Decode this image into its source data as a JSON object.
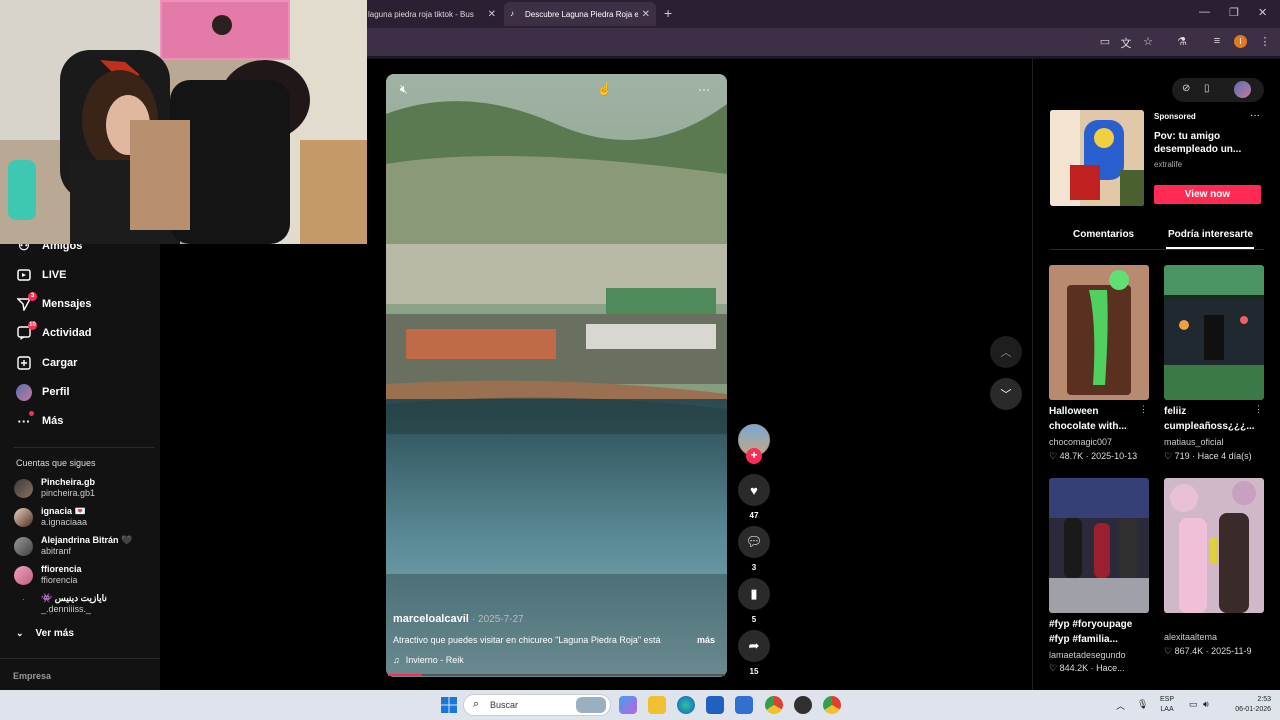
{
  "browser": {
    "tabs": [
      {
        "title": "laguna piedra roja tiktok - Bus",
        "active": false
      },
      {
        "title": "Descubre Laguna Piedra Roja e",
        "active": true
      }
    ],
    "new_tab_icon": "plus-icon"
  },
  "sidebar": {
    "items": [
      {
        "label": "Amigos",
        "icon": "friends-icon",
        "badge": ""
      },
      {
        "label": "LIVE",
        "icon": "live-icon",
        "badge": ""
      },
      {
        "label": "Mensajes",
        "icon": "messages-icon",
        "badge": "3"
      },
      {
        "label": "Actividad",
        "icon": "activity-icon",
        "badge": "10"
      },
      {
        "label": "Cargar",
        "icon": "upload-icon",
        "badge": ""
      },
      {
        "label": "Perfil",
        "icon": "profile-icon",
        "badge": ""
      },
      {
        "label": "Más",
        "icon": "more-icon",
        "badge": ""
      }
    ],
    "following_title": "Cuentas que sigues",
    "accounts": [
      {
        "name": "Pincheira.gb",
        "handle": "pincheira.gb1"
      },
      {
        "name": "ignacia 💌",
        "handle": "a.ignaciaaa"
      },
      {
        "name": "Alejandrina Bitrán 🖤",
        "handle": "abitranf"
      },
      {
        "name": "ffiorencia",
        "handle": "ffiorencia"
      },
      {
        "name": "👾 نايازيت دينيس",
        "handle": "_.denniiiss._"
      }
    ],
    "see_more": "Ver más",
    "company": "Empresa"
  },
  "video": {
    "username": "marceloalcavil",
    "date": "2025-7-27",
    "caption": "Atractivo que puedes visitar en chicureo \"Laguna Piedra Roja\" está",
    "more": "más",
    "music": "Invierno - Reik",
    "likes": "47",
    "comments": "3",
    "saves": "5",
    "shares": "15",
    "progress": 0.1
  },
  "ad": {
    "sponsored": "Sponsored",
    "title": "Pov: tu amigo desempleado un...",
    "brand": "extralife",
    "cta": "View now"
  },
  "right_tabs": {
    "comments": "Comentarios",
    "suggested": "Podría interesarte"
  },
  "cards": [
    {
      "title": "Halloween chocolate with...",
      "author": "chocomagic007",
      "likes": "48.7K",
      "date": "2025-10-13"
    },
    {
      "title": "feliiz cumpleañoss¿¿¿...",
      "author": "matiaus_oficial",
      "likes": "719",
      "date": "Hace 4 día(s)"
    },
    {
      "title": "#fyp #foryoupage #fyp #familia...",
      "author": "lamaetadesegundo",
      "likes": "844.2K",
      "date": "Hace..."
    },
    {
      "title": "",
      "author": "alexitaaltema",
      "likes": "867.4K",
      "date": "2025-11-9"
    }
  ],
  "taskbar": {
    "search_placeholder": "Buscar",
    "lang_top": "ESP",
    "lang_bottom": "LAA",
    "time": "2:53",
    "date": "06-01-2026"
  }
}
